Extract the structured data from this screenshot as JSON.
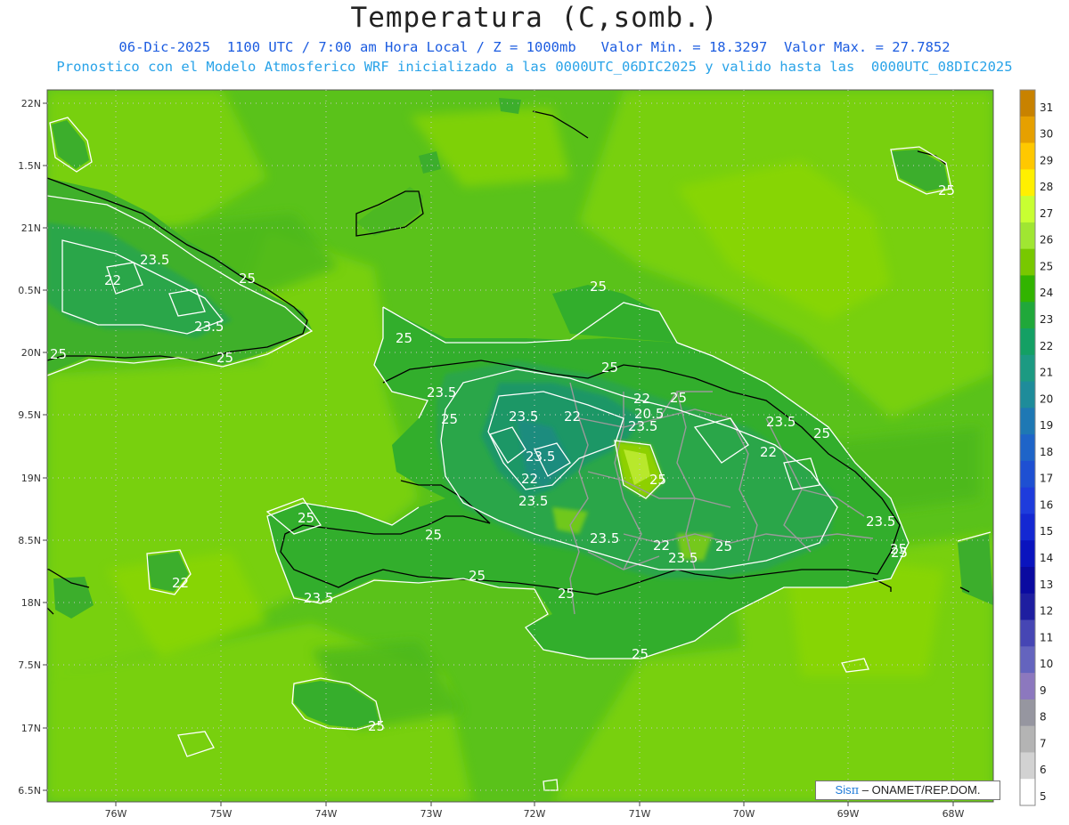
{
  "header": {
    "title": "Temperatura (C,somb.)",
    "line1": "06-Dic-2025  1100 UTC / 7:00 am Hora Local / Z = 1000mb   Valor Min. = 18.3297  Valor Max. = 27.7852",
    "line2": "Pronostico con el Modelo Atmosferico WRF inicializado a las 0000UTC_06DIC2025 y valido hasta las  0000UTC_08DIC2025"
  },
  "axes": {
    "lon_labels": [
      "76W",
      "75W",
      "74W",
      "73W",
      "72W",
      "71W",
      "70W",
      "69W",
      "68W"
    ],
    "lat_labels": [
      "22N",
      "1.5N",
      "21N",
      "0.5N",
      "20N",
      "9.5N",
      "19N",
      "8.5N",
      "18N",
      "7.5N",
      "17N",
      "6.5N"
    ]
  },
  "colorbar": {
    "levels": [
      "31",
      "30",
      "29",
      "28",
      "27",
      "26",
      "25",
      "24",
      "23",
      "22",
      "21",
      "20",
      "19",
      "18",
      "17",
      "16",
      "15",
      "14",
      "13",
      "12",
      "11",
      "10",
      "9",
      "8",
      "7",
      "6",
      "5"
    ],
    "colors": [
      "#c88200",
      "#e6a000",
      "#ffc800",
      "#fff000",
      "#c8ff32",
      "#a0e632",
      "#78c800",
      "#32b400",
      "#20a83a",
      "#14a064",
      "#1c9a82",
      "#1e8c9a",
      "#1e78b4",
      "#1e64c8",
      "#1e50d2",
      "#1e3cdc",
      "#1428d2",
      "#0a14be",
      "#0a0aa0",
      "#1e1ea0",
      "#4646b4",
      "#6464be",
      "#8c78be",
      "#9696a0",
      "#b4b4b4",
      "#d2d2d2",
      "#ffffff"
    ]
  },
  "contour_labels": [
    "25",
    "25",
    "25",
    "23.5",
    "22",
    "23.5",
    "25",
    "25",
    "25",
    "23.5",
    "25",
    "23.5",
    "23.5",
    "22",
    "20.5",
    "22",
    "23.5",
    "22",
    "25",
    "22",
    "23.5",
    "25",
    "23.5",
    "22",
    "23.5",
    "25",
    "25",
    "25",
    "25",
    "25",
    "23.5",
    "22",
    "23.5",
    "23.5",
    "25",
    "25",
    "25",
    "25",
    "25",
    "25"
  ],
  "credit": {
    "sis": "Sis",
    "pi": "π",
    "text": " – ONAMET/REP.DOM."
  }
}
